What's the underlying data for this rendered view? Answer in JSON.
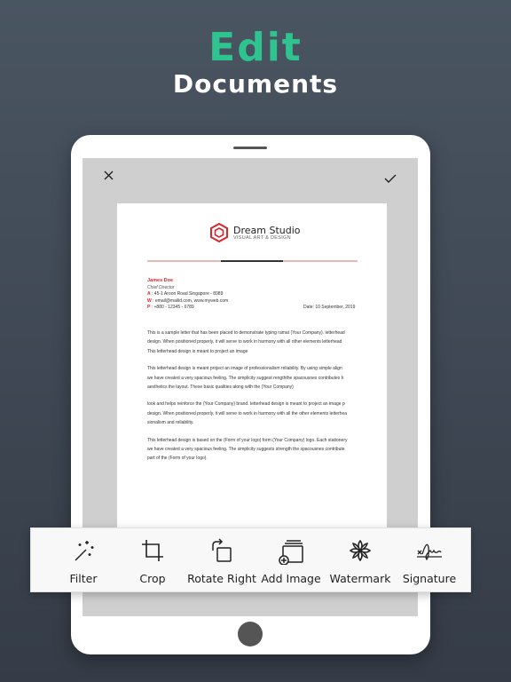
{
  "hero": {
    "title": "Edit",
    "subtitle": "Documents",
    "title_color": "#2fc38f"
  },
  "document": {
    "brand_name": "Dream Studio",
    "brand_tagline": "VISUAL ART & DESIGN",
    "sender_name": "James Doe",
    "sender_role": "Chief Director",
    "address_label": "A",
    "address": ": 45-1 Aroon Road Singapore - 8989",
    "web_label": "W",
    "web": ": email@mailid.com, www.myweb.com",
    "phone_label": "P",
    "phone": ": +880 - 12345 - 6789",
    "date": "Date: 10 September, 2019",
    "lines": [
      "This is a sample letter that has been placed to demonstrate typing ramat (Your Company). letterhead",
      "design. When positioned properly, it will serve to work in harmony with all other elements letterhead",
      "This letterhead design is meant to project an image",
      "This letterhead design is meant project an image of professionalism reliability. By using simple align",
      "we have created a very spacious feeling. The simplicity suggest  rengththe spacousnes contributes h",
      "aesthetics the layout. These basic qualities along with the (Your Company)",
      "look and helps reinforce the (Your Company) brand. letterhead design is meant to project an image p",
      "design. When positioned properly, it will serve to work in harmony with all the other elements letterhea",
      "sionalism and reliability.",
      "This letterhead design is based on the (Form of your logo) form (Your Company) logo. Each stationery",
      "we have created a very spacious feeling. The simplicity suggests strength the spacousnes contribute",
      "part of the (Form of your logo)."
    ],
    "brand_color": "#d9262c"
  },
  "toolbar": {
    "items": [
      {
        "label": "Filter",
        "icon": "magic-wand-icon"
      },
      {
        "label": "Crop",
        "icon": "crop-icon"
      },
      {
        "label": "Rotate Right",
        "icon": "rotate-right-icon"
      },
      {
        "label": "Add Image",
        "icon": "add-image-icon"
      },
      {
        "label": "Watermark",
        "icon": "watermark-icon"
      },
      {
        "label": "Signature",
        "icon": "signature-icon"
      }
    ]
  }
}
